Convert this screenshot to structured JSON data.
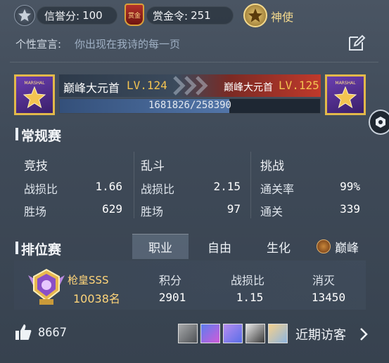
{
  "top": {
    "credit_label": "信誉分:",
    "credit_value": "100",
    "bounty_label": "赏金令:",
    "bounty_value": "251",
    "bounty_badge": "赏金",
    "role_label": "神使"
  },
  "motto": {
    "label": "个性宣言:",
    "text": "你出现在我诗的每一页"
  },
  "rank_bar": {
    "left_title": "巅峰大元首",
    "left_level": "LV.124",
    "right_title": "巅峰大元首",
    "right_level": "LV.125",
    "progress_text": "1681826/258390",
    "progress_fraction": 0.65,
    "badge_text": "MARSHAL"
  },
  "regular": {
    "title": "常规赛",
    "columns": [
      {
        "name": "竞技",
        "rows": [
          {
            "label": "战损比",
            "value": "1.66"
          },
          {
            "label": "胜场",
            "value": "629"
          }
        ]
      },
      {
        "name": "乱斗",
        "rows": [
          {
            "label": "战损比",
            "value": "2.15"
          },
          {
            "label": "胜场",
            "value": "97"
          }
        ]
      },
      {
        "name": "挑战",
        "rows": [
          {
            "label": "通关率",
            "value": "99%"
          },
          {
            "label": "通关",
            "value": "339"
          }
        ]
      }
    ]
  },
  "ranked": {
    "title": "排位赛",
    "tabs": [
      "职业",
      "自由",
      "生化",
      "巅峰"
    ],
    "active_tab": 0,
    "rank_name": "枪皇SSS",
    "rank_position": "10038名",
    "stats": [
      {
        "label": "积分",
        "value": "2901"
      },
      {
        "label": "战损比",
        "value": "1.15"
      },
      {
        "label": "消灭",
        "value": "13450"
      }
    ]
  },
  "footer": {
    "likes": "8667",
    "visitors_label": "近期访客"
  },
  "colors": {
    "gold": "#f4c451",
    "red_bar": "#c0392b",
    "progress_blue": "#3c5a86"
  }
}
